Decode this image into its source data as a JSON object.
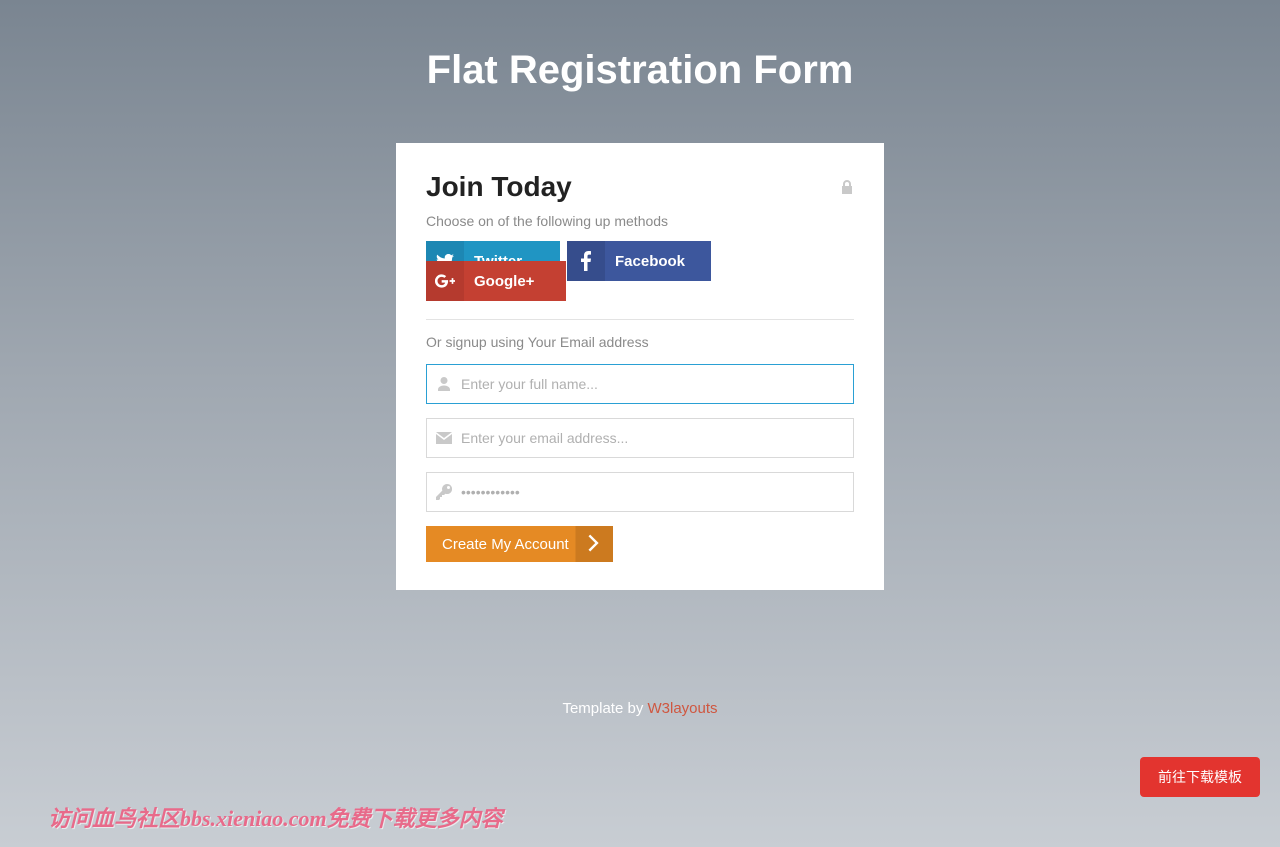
{
  "page": {
    "title": "Flat Registration Form"
  },
  "card": {
    "heading": "Join Today",
    "subtitle": "Choose on of the following up methods",
    "email_label": "Or signup using Your Email address"
  },
  "social": {
    "twitter": "Twitter",
    "facebook": "Facebook",
    "google": "Google+"
  },
  "inputs": {
    "name_placeholder": "Enter your full name...",
    "email_placeholder": "Enter your email address...",
    "password_placeholder": "••••••••••••"
  },
  "submit": {
    "label": "Create My Account"
  },
  "footer": {
    "prefix": "Template by ",
    "link": "W3layouts"
  },
  "overlay": {
    "download": "前往下载模板",
    "watermark": "访问血鸟社区bbs.xieniao.com免费下载更多内容"
  }
}
